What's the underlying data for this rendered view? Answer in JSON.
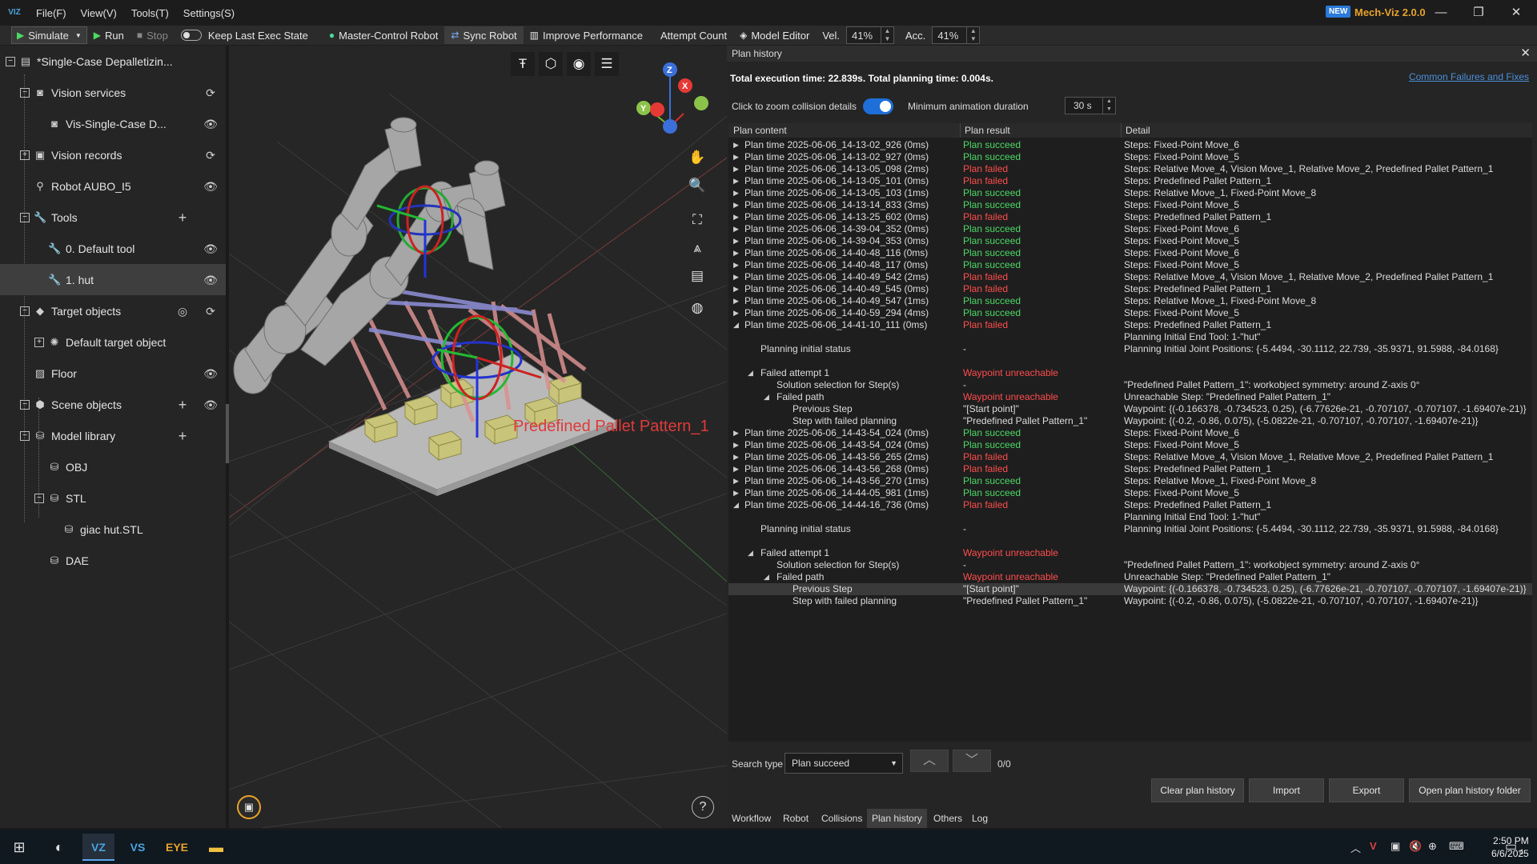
{
  "menubar": {
    "logo": "VIZ",
    "menus": [
      "File(F)",
      "View(V)",
      "Tools(T)",
      "Settings(S)"
    ],
    "badge": "NEW",
    "app_version": "Mech-Viz 2.0.0",
    "min": "—",
    "max": "❐",
    "close": "✕"
  },
  "toolbar": {
    "simulate": "Simulate",
    "run": "Run",
    "stop": "Stop",
    "keep_last": "Keep Last Exec State",
    "master_control": "Master-Control Robot",
    "sync_robot": "Sync Robot",
    "improve_perf": "Improve Performance",
    "attempt_count": "Attempt Count",
    "model_editor": "Model Editor",
    "vel_label": "Vel.",
    "vel_value": "41%",
    "acc_label": "Acc.",
    "acc_value": "41%"
  },
  "tree": {
    "root": "*Single-Case Depalletizin...",
    "vision_services": "Vision services",
    "vis_single": "Vis-Single-Case D...",
    "vision_records": "Vision records",
    "robot": "Robot AUBO_I5",
    "tools": "Tools",
    "default_tool": "0. Default tool",
    "hut": "1. hut",
    "target_objects": "Target objects",
    "default_target": "Default target object",
    "floor": "Floor",
    "scene_objects": "Scene objects",
    "model_library": "Model library",
    "obj": "OBJ",
    "stl": "STL",
    "giac": "giac hut.STL",
    "dae": "DAE"
  },
  "viewport": {
    "pattern_label": "Predefined Pallet Pattern_1",
    "axis_z": "Z",
    "axis_y": "Y",
    "axis_x": "X",
    "help": "?"
  },
  "plan_history": {
    "title": "Plan history",
    "close": "✕",
    "summary": "Total execution time: 22.839s. Total planning time: 0.004s.",
    "link": "Common Failures and Fixes",
    "zoom_label": "Click to zoom collision details",
    "min_anim_label": "Minimum animation duration",
    "min_anim_value": "30 s",
    "col_content": "Plan content",
    "col_result": "Plan result",
    "col_detail": "Detail",
    "rows": [
      {
        "tri": "▶",
        "indent": 0,
        "content": "Plan time 2025-06-06_14-13-02_926 (0ms)",
        "result": "Plan succeed",
        "status": "ok",
        "detail": "Steps: Fixed-Point Move_6"
      },
      {
        "tri": "▶",
        "indent": 0,
        "content": "Plan time 2025-06-06_14-13-02_927 (0ms)",
        "result": "Plan succeed",
        "status": "ok",
        "detail": "Steps: Fixed-Point Move_5"
      },
      {
        "tri": "▶",
        "indent": 0,
        "content": "Plan time 2025-06-06_14-13-05_098 (2ms)",
        "result": "Plan failed",
        "status": "fail",
        "detail": "Steps: Relative Move_4, Vision Move_1, Relative Move_2, Predefined Pallet Pattern_1"
      },
      {
        "tri": "▶",
        "indent": 0,
        "content": "Plan time 2025-06-06_14-13-05_101 (0ms)",
        "result": "Plan failed",
        "status": "fail",
        "detail": "Steps: Predefined Pallet Pattern_1"
      },
      {
        "tri": "▶",
        "indent": 0,
        "content": "Plan time 2025-06-06_14-13-05_103 (1ms)",
        "result": "Plan succeed",
        "status": "ok",
        "detail": "Steps: Relative Move_1, Fixed-Point Move_8"
      },
      {
        "tri": "▶",
        "indent": 0,
        "content": "Plan time 2025-06-06_14-13-14_833 (3ms)",
        "result": "Plan succeed",
        "status": "ok",
        "detail": "Steps: Fixed-Point Move_5"
      },
      {
        "tri": "▶",
        "indent": 0,
        "content": "Plan time 2025-06-06_14-13-25_602 (0ms)",
        "result": "Plan failed",
        "status": "fail",
        "detail": "Steps: Predefined Pallet Pattern_1"
      },
      {
        "tri": "▶",
        "indent": 0,
        "content": "Plan time 2025-06-06_14-39-04_352 (0ms)",
        "result": "Plan succeed",
        "status": "ok",
        "detail": "Steps: Fixed-Point Move_6"
      },
      {
        "tri": "▶",
        "indent": 0,
        "content": "Plan time 2025-06-06_14-39-04_353 (0ms)",
        "result": "Plan succeed",
        "status": "ok",
        "detail": "Steps: Fixed-Point Move_5"
      },
      {
        "tri": "▶",
        "indent": 0,
        "content": "Plan time 2025-06-06_14-40-48_116 (0ms)",
        "result": "Plan succeed",
        "status": "ok",
        "detail": "Steps: Fixed-Point Move_6"
      },
      {
        "tri": "▶",
        "indent": 0,
        "content": "Plan time 2025-06-06_14-40-48_117 (0ms)",
        "result": "Plan succeed",
        "status": "ok",
        "detail": "Steps: Fixed-Point Move_5"
      },
      {
        "tri": "▶",
        "indent": 0,
        "content": "Plan time 2025-06-06_14-40-49_542 (2ms)",
        "result": "Plan failed",
        "status": "fail",
        "detail": "Steps: Relative Move_4, Vision Move_1, Relative Move_2, Predefined Pallet Pattern_1"
      },
      {
        "tri": "▶",
        "indent": 0,
        "content": "Plan time 2025-06-06_14-40-49_545 (0ms)",
        "result": "Plan failed",
        "status": "fail",
        "detail": "Steps: Predefined Pallet Pattern_1"
      },
      {
        "tri": "▶",
        "indent": 0,
        "content": "Plan time 2025-06-06_14-40-49_547 (1ms)",
        "result": "Plan succeed",
        "status": "ok",
        "detail": "Steps: Relative Move_1, Fixed-Point Move_8"
      },
      {
        "tri": "▶",
        "indent": 0,
        "content": "Plan time 2025-06-06_14-40-59_294 (4ms)",
        "result": "Plan succeed",
        "status": "ok",
        "detail": "Steps: Fixed-Point Move_5"
      },
      {
        "tri": "◢",
        "indent": 0,
        "content": "Plan time 2025-06-06_14-41-10_111 (0ms)",
        "result": "Plan failed",
        "status": "fail",
        "detail": "Steps: Predefined Pallet Pattern_1"
      },
      {
        "tri": "",
        "indent": 0,
        "content": "",
        "result": "",
        "status": "",
        "detail": "Planning Initial End Tool: 1-\"hut\""
      },
      {
        "tri": "",
        "indent": 1,
        "content": "Planning initial status",
        "result": "-",
        "status": "",
        "detail": "Planning Initial Joint Positions: {-5.4494, -30.1112, 22.739, -35.9371, 91.5988, -84.0168}"
      },
      {
        "tri": "",
        "indent": 0,
        "content": "",
        "result": "",
        "status": "",
        "detail": ""
      },
      {
        "tri": "◢",
        "indent": 1,
        "content": "Failed attempt 1",
        "result": "Waypoint unreachable",
        "status": "fail",
        "detail": ""
      },
      {
        "tri": "",
        "indent": 2,
        "content": "Solution selection for Step(s)",
        "result": "-",
        "status": "",
        "detail": "\"Predefined Pallet Pattern_1\": workobject symmetry: around Z-axis 0°"
      },
      {
        "tri": "◢",
        "indent": 2,
        "content": "Failed path",
        "result": "Waypoint unreachable",
        "status": "fail",
        "detail": "Unreachable Step: \"Predefined Pallet Pattern_1\""
      },
      {
        "tri": "",
        "indent": 3,
        "content": "Previous Step",
        "result": "\"[Start point]\"",
        "status": "",
        "detail": "Waypoint: {(-0.166378, -0.734523, 0.25), (-6.77626e-21, -0.707107, -0.707107, -1.69407e-21)}"
      },
      {
        "tri": "",
        "indent": 3,
        "content": "Step with failed planning",
        "result": "\"Predefined Pallet Pattern_1\"",
        "status": "",
        "detail": "Waypoint: {(-0.2, -0.86, 0.075), (-5.0822e-21, -0.707107, -0.707107, -1.69407e-21)}"
      },
      {
        "tri": "▶",
        "indent": 0,
        "content": "Plan time 2025-06-06_14-43-54_024 (0ms)",
        "result": "Plan succeed",
        "status": "ok",
        "detail": "Steps: Fixed-Point Move_6"
      },
      {
        "tri": "▶",
        "indent": 0,
        "content": "Plan time 2025-06-06_14-43-54_024 (0ms)",
        "result": "Plan succeed",
        "status": "ok",
        "detail": "Steps: Fixed-Point Move_5"
      },
      {
        "tri": "▶",
        "indent": 0,
        "content": "Plan time 2025-06-06_14-43-56_265 (2ms)",
        "result": "Plan failed",
        "status": "fail",
        "detail": "Steps: Relative Move_4, Vision Move_1, Relative Move_2, Predefined Pallet Pattern_1"
      },
      {
        "tri": "▶",
        "indent": 0,
        "content": "Plan time 2025-06-06_14-43-56_268 (0ms)",
        "result": "Plan failed",
        "status": "fail",
        "detail": "Steps: Predefined Pallet Pattern_1"
      },
      {
        "tri": "▶",
        "indent": 0,
        "content": "Plan time 2025-06-06_14-43-56_270 (1ms)",
        "result": "Plan succeed",
        "status": "ok",
        "detail": "Steps: Relative Move_1, Fixed-Point Move_8"
      },
      {
        "tri": "▶",
        "indent": 0,
        "content": "Plan time 2025-06-06_14-44-05_981 (1ms)",
        "result": "Plan succeed",
        "status": "ok",
        "detail": "Steps: Fixed-Point Move_5"
      },
      {
        "tri": "◢",
        "indent": 0,
        "content": "Plan time 2025-06-06_14-44-16_736 (0ms)",
        "result": "Plan failed",
        "status": "fail",
        "detail": "Steps: Predefined Pallet Pattern_1"
      },
      {
        "tri": "",
        "indent": 0,
        "content": "",
        "result": "",
        "status": "",
        "detail": "Planning Initial End Tool: 1-\"hut\""
      },
      {
        "tri": "",
        "indent": 1,
        "content": "Planning initial status",
        "result": "-",
        "status": "",
        "detail": "Planning Initial Joint Positions: {-5.4494, -30.1112, 22.739, -35.9371, 91.5988, -84.0168}"
      },
      {
        "tri": "",
        "indent": 0,
        "content": "",
        "result": "",
        "status": "",
        "detail": ""
      },
      {
        "tri": "◢",
        "indent": 1,
        "content": "Failed attempt 1",
        "result": "Waypoint unreachable",
        "status": "fail",
        "detail": ""
      },
      {
        "tri": "",
        "indent": 2,
        "content": "Solution selection for Step(s)",
        "result": "-",
        "status": "",
        "detail": "\"Predefined Pallet Pattern_1\": workobject symmetry: around Z-axis 0°"
      },
      {
        "tri": "◢",
        "indent": 2,
        "content": "Failed path",
        "result": "Waypoint unreachable",
        "status": "fail",
        "detail": "Unreachable Step: \"Predefined Pallet Pattern_1\""
      },
      {
        "tri": "",
        "indent": 3,
        "content": "Previous Step",
        "result": "\"[Start point]\"",
        "status": "",
        "detail": "Waypoint: {(-0.166378, -0.734523, 0.25), (-6.77626e-21, -0.707107, -0.707107, -1.69407e-21)}",
        "highlight": true
      },
      {
        "tri": "",
        "indent": 3,
        "content": "Step with failed planning",
        "result": "\"Predefined Pallet Pattern_1\"",
        "status": "",
        "detail": "Waypoint: {(-0.2, -0.86, 0.075), (-5.0822e-21, -0.707107, -0.707107, -1.69407e-21)}"
      }
    ],
    "search_label": "Search type",
    "search_value": "Plan succeed",
    "count": "0/0",
    "up": "︿",
    "down": "﹀",
    "clear": "Clear plan history",
    "import": "Import",
    "export": "Export",
    "open_folder": "Open plan history folder",
    "tabs": [
      "Workflow",
      "Robot",
      "Collisions",
      "Plan history",
      "Others",
      "Log"
    ],
    "active_tab": "Plan history"
  },
  "taskbar": {
    "time": "2:50 PM",
    "date": "6/6/2025",
    "notif": "4"
  },
  "colors": {
    "ok": "#4cd964",
    "fail": "#ff4d4d",
    "accent": "#1e6fd8",
    "brand": "#e8a22c"
  }
}
